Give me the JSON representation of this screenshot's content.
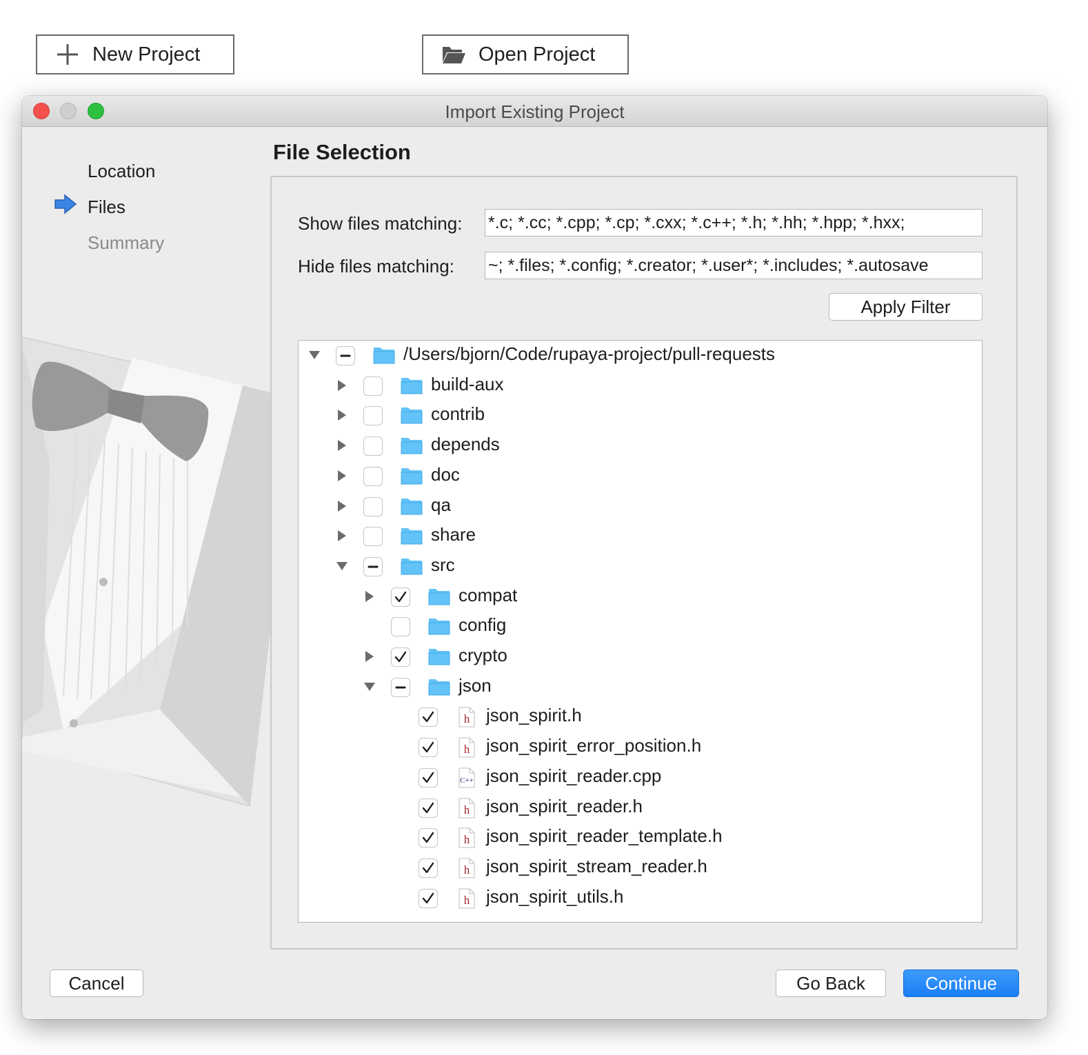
{
  "launcher": {
    "new_project_label": "New Project",
    "new_project_icon": "plus-icon",
    "open_project_label": "Open Project",
    "open_project_icon": "folder-open-icon"
  },
  "window": {
    "title": "Import Existing Project",
    "traffic_lights": [
      "#f4504c",
      "#cfcfcf",
      "#2bc13f"
    ]
  },
  "steps": [
    {
      "label": "Location",
      "state": "done"
    },
    {
      "label": "Files",
      "state": "current"
    },
    {
      "label": "Summary",
      "state": "pending"
    }
  ],
  "page": {
    "title": "File Selection",
    "show_label": "Show files matching:",
    "show_value": "*.c; *.cc; *.cpp; *.cp; *.cxx; *.c++; *.h; *.hh; *.hpp; *.hxx;",
    "hide_label": "Hide files matching:",
    "hide_value": "~; *.files; *.config; *.creator; *.user*; *.includes; *.autosave",
    "apply_label": "Apply Filter"
  },
  "tree": [
    {
      "depth": 0,
      "expand": "open",
      "check": "partial",
      "icon": "folder",
      "label": "/Users/bjorn/Code/rupaya-project/pull-requests"
    },
    {
      "depth": 1,
      "expand": "closed",
      "check": "unchecked",
      "icon": "folder",
      "label": "build-aux"
    },
    {
      "depth": 1,
      "expand": "closed",
      "check": "unchecked",
      "icon": "folder",
      "label": "contrib"
    },
    {
      "depth": 1,
      "expand": "closed",
      "check": "unchecked",
      "icon": "folder",
      "label": "depends"
    },
    {
      "depth": 1,
      "expand": "closed",
      "check": "unchecked",
      "icon": "folder",
      "label": "doc"
    },
    {
      "depth": 1,
      "expand": "closed",
      "check": "unchecked",
      "icon": "folder",
      "label": "qa"
    },
    {
      "depth": 1,
      "expand": "closed",
      "check": "unchecked",
      "icon": "folder",
      "label": "share"
    },
    {
      "depth": 1,
      "expand": "open",
      "check": "partial",
      "icon": "folder",
      "label": "src"
    },
    {
      "depth": 2,
      "expand": "closed",
      "check": "checked",
      "icon": "folder",
      "label": "compat"
    },
    {
      "depth": 2,
      "expand": "none",
      "check": "unchecked",
      "icon": "folder",
      "label": "config"
    },
    {
      "depth": 2,
      "expand": "closed",
      "check": "checked",
      "icon": "folder",
      "label": "crypto"
    },
    {
      "depth": 2,
      "expand": "open",
      "check": "partial",
      "icon": "folder",
      "label": "json"
    },
    {
      "depth": 3,
      "expand": "none",
      "check": "checked",
      "icon": "header-file",
      "label": "json_spirit.h"
    },
    {
      "depth": 3,
      "expand": "none",
      "check": "checked",
      "icon": "header-file",
      "label": "json_spirit_error_position.h"
    },
    {
      "depth": 3,
      "expand": "none",
      "check": "checked",
      "icon": "cpp-file",
      "label": "json_spirit_reader.cpp"
    },
    {
      "depth": 3,
      "expand": "none",
      "check": "checked",
      "icon": "header-file",
      "label": "json_spirit_reader.h"
    },
    {
      "depth": 3,
      "expand": "none",
      "check": "checked",
      "icon": "header-file",
      "label": "json_spirit_reader_template.h"
    },
    {
      "depth": 3,
      "expand": "none",
      "check": "checked",
      "icon": "header-file",
      "label": "json_spirit_stream_reader.h"
    },
    {
      "depth": 3,
      "expand": "none",
      "check": "checked",
      "icon": "header-file",
      "label": "json_spirit_utils.h"
    }
  ],
  "footer": {
    "cancel_label": "Cancel",
    "back_label": "Go Back",
    "continue_label": "Continue"
  },
  "colors": {
    "accent": "#1a7ef5",
    "folder": "#63c2f7",
    "header_glyph": "#a3282e",
    "cpp_glyph": "#2d2d85",
    "step_arrow": "#3a86e4"
  }
}
